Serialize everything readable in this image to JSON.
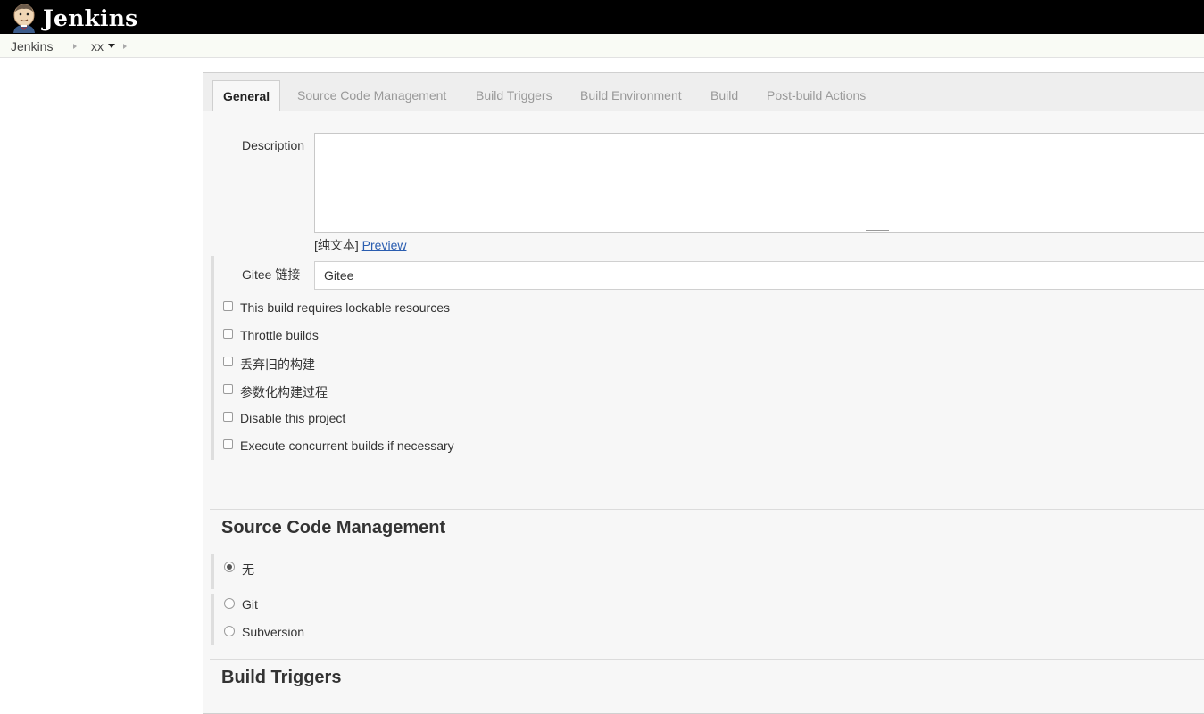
{
  "header": {
    "logo_text": "Jenkins",
    "logo_icon": "jenkins-butler-icon"
  },
  "breadcrumb": {
    "items": [
      {
        "label": "Jenkins"
      },
      {
        "label": "xx"
      }
    ]
  },
  "tabs": [
    {
      "label": "General",
      "active": true
    },
    {
      "label": "Source Code Management",
      "active": false
    },
    {
      "label": "Build Triggers",
      "active": false
    },
    {
      "label": "Build Environment",
      "active": false
    },
    {
      "label": "Build",
      "active": false
    },
    {
      "label": "Post-build Actions",
      "active": false
    }
  ],
  "general": {
    "description_label": "Description",
    "description_value": "",
    "text_mode": "[纯文本]",
    "preview_link": "Preview",
    "gitee_label": "Gitee 链接",
    "gitee_value": "Gitee",
    "options": [
      {
        "label": "This build requires lockable resources",
        "checked": false
      },
      {
        "label": "Throttle builds",
        "checked": false
      },
      {
        "label": "丢弃旧的构建",
        "checked": false
      },
      {
        "label": "参数化构建过程",
        "checked": false
      },
      {
        "label": "Disable this project",
        "checked": false
      },
      {
        "label": "Execute concurrent builds if necessary",
        "checked": false
      }
    ]
  },
  "scm": {
    "title": "Source Code Management",
    "options": [
      {
        "label": "无",
        "selected": true
      },
      {
        "label": "Git",
        "selected": false
      },
      {
        "label": "Subversion",
        "selected": false
      }
    ]
  },
  "build_triggers": {
    "title": "Build Triggers"
  },
  "colors": {
    "header_bg": "#000000",
    "link": "#2a5db0",
    "panel_bg": "#f7f7f7"
  }
}
